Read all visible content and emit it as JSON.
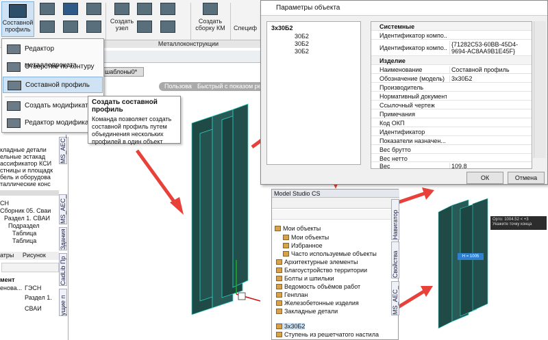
{
  "ribbon": {
    "composite_label": "Составной\nпрофиль",
    "node_label": "Создать\nузел",
    "assembly_label": "Создать\nсборку КМ",
    "spec_label": "Специф",
    "group_label": "Металлоконструкции"
  },
  "dropdown": {
    "items": [
      {
        "label": "Редактор металлопроката"
      },
      {
        "label": "Отверстие по контуру"
      },
      {
        "label": "Составной профиль"
      },
      {
        "label": "Создать модификатор"
      },
      {
        "label": "Редактор модификатор"
      }
    ]
  },
  "tooltip": {
    "title": "Создать составной профиль",
    "body": "Команда позволяет создать составной профиль путем объединения нескольких профилей в один объект"
  },
  "viewport": {
    "tab_label": "шаблоны0*",
    "view_pill": "Пользовательский вид",
    "mode_pill": "Быстрый с показом ребер"
  },
  "left_panel": {
    "tree_items": [
      "кладные детали",
      "ельные эстакад",
      "ассификатор КСИ",
      "стницы и площадк",
      "бель и оборудова",
      "таллические конс"
    ],
    "rows2": [
      "СН",
      "Сборник 05. Сваи",
      "Раздел 1. СВАИ",
      "Подраздел",
      "Таблица",
      "Таблица"
    ],
    "tabs": [
      "атры",
      "Рисунок"
    ],
    "table_header": "мент",
    "table_header2": "ГЭСН",
    "table_cells": [
      "енова...",
      "Раздел 1.",
      "СВАИ"
    ],
    "side_tabs": [
      "MS_AEC_",
      "MS_AEC_",
      "Здания",
      "CadLib Пр",
      "ущие п"
    ]
  },
  "dialog": {
    "title": "Параметры объекта",
    "tree_root": "3x30Б2",
    "tree_children": [
      "30Б2",
      "30Б2",
      "30Б2"
    ],
    "rows": [
      {
        "key": "Системные",
        "value": "",
        "header": true
      },
      {
        "key": "Идентификатор компо...",
        "value": ""
      },
      {
        "key": "Идентификатор компо...",
        "value": "{71282C53-60BB-45D4-9694-AC8AA9B1E45F}"
      },
      {
        "key": "Изделие",
        "value": "",
        "header": true
      },
      {
        "key": "Наименование",
        "value": "Составной профиль"
      },
      {
        "key": "Обозначение (модель)",
        "value": "3x30Б2"
      },
      {
        "key": "Производитель",
        "value": ""
      },
      {
        "key": "Нормативный документ",
        "value": ""
      },
      {
        "key": "Ссылочный чертеж",
        "value": ""
      },
      {
        "key": "Примечания",
        "value": ""
      },
      {
        "key": "Код ОКП",
        "value": ""
      },
      {
        "key": "Идентификатор",
        "value": ""
      },
      {
        "key": "Показатели назначен...",
        "value": ""
      },
      {
        "key": "Вес брутто",
        "value": ""
      },
      {
        "key": "Вес нетто",
        "value": ""
      },
      {
        "key": "Вес",
        "value": "109.8"
      }
    ],
    "ok_label": "ОК",
    "cancel_label": "Отмена"
  },
  "model_studio": {
    "title": "Model Studio CS",
    "root": "Мои объекты",
    "items": [
      "Мои объекты",
      "Избранное",
      "Часто используемые объекты",
      "Архитектурные элементы",
      "Благоустройство территории",
      "Болты и шпильки",
      "Ведомость объёмов работ",
      "Генплан",
      "Железобетонные изделия",
      "Закладные детали"
    ],
    "bottom_items": [
      "3x30Б2",
      "Ступень из решетчатого настила"
    ],
    "side_tabs": [
      "Навигатор",
      "Свойства",
      "MS_AEC_"
    ]
  },
  "model_view": {
    "snap_label": "Орто: 1004.52 < +3",
    "snap_hint": "Укажите точку конца",
    "dim_label": "Н = 1005"
  },
  "colors": {
    "steel": "#1f4a46",
    "steel_edge": "#2fd4c8",
    "arrow": "#e8413a",
    "selection": "#cfe3f5"
  }
}
